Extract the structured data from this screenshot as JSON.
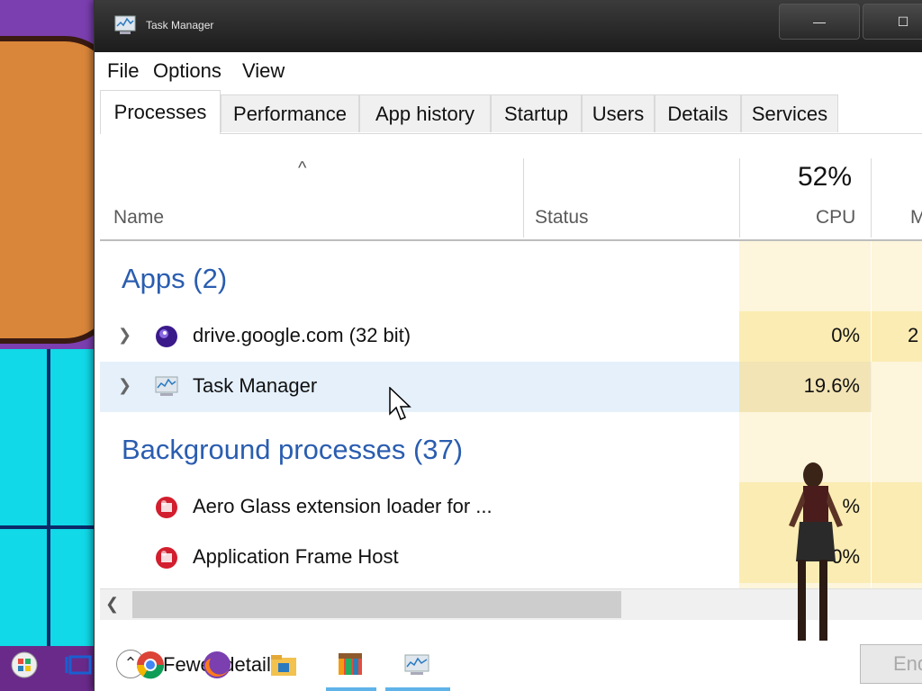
{
  "window": {
    "title": "Task Manager",
    "minimize_glyph": "—",
    "maximize_glyph": "☐"
  },
  "menu": [
    "File",
    "Options",
    "View"
  ],
  "tabs": [
    "Processes",
    "Performance",
    "App history",
    "Startup",
    "Users",
    "Details",
    "Services"
  ],
  "columns": {
    "sort_indicator": "^",
    "name": "Name",
    "status": "Status",
    "cpu_percent": "52%",
    "cpu": "CPU",
    "mem_partial": "M"
  },
  "groups": {
    "apps_title": "Apps (2)",
    "background_title": "Background processes (37)"
  },
  "rows": [
    {
      "name": "drive.google.com (32 bit)",
      "cpu": "0%",
      "mem": "2",
      "expandable": true
    },
    {
      "name": "Task Manager",
      "cpu": "19.6%",
      "mem": "",
      "expandable": true
    },
    {
      "name": "Aero Glass extension loader for ...",
      "cpu": "%",
      "mem": "",
      "expandable": false
    },
    {
      "name": "Application Frame Host",
      "cpu": "0%",
      "mem": "",
      "expandable": false
    }
  ],
  "bottom": {
    "fewer_details": "Fewer details",
    "end_task": "End"
  },
  "colors": {
    "group_title": "#2a5db0",
    "cpu_heat": "#fbecb3",
    "selected_row": "#e5f0fb"
  }
}
